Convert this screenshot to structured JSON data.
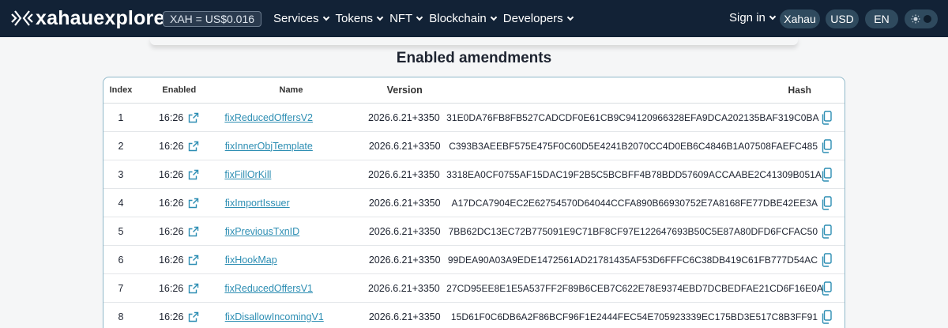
{
  "header": {
    "logo_text": "xahauexplorer",
    "price": "XAH = US$0.016",
    "nav": [
      "Services",
      "Tokens",
      "NFT",
      "Blockchain",
      "Developers"
    ],
    "signin": "Sign in",
    "network": "Xahau",
    "currency": "USD",
    "language": "EN",
    "accent": "#2f4a5e"
  },
  "page": {
    "title": "Enabled amendments"
  },
  "table": {
    "headers": {
      "index": "Index",
      "enabled": "Enabled",
      "name": "Name",
      "version": "Version",
      "hash": "Hash"
    },
    "rows": [
      {
        "index": "1",
        "enabled": "16:26",
        "name": "fixReducedOffersV2",
        "version": "2026.6.21+3350",
        "hash": "31E0DA76FB8FB527CADCDF0E61CB9C94120966328EFA9DCA202135BAF319C0BA"
      },
      {
        "index": "2",
        "enabled": "16:26",
        "name": "fixInnerObjTemplate",
        "version": "2026.6.21+3350",
        "hash": "C393B3AEEBF575E475F0C60D5E4241B2070CC4D0EB6C4846B1A07508FAEFC485"
      },
      {
        "index": "3",
        "enabled": "16:26",
        "name": "fixFillOrKill",
        "version": "2026.6.21+3350",
        "hash": "3318EA0CF0755AF15DAC19F2B5C5BCBFF4B78BDD57609ACCAABE2C41309B051A"
      },
      {
        "index": "4",
        "enabled": "16:26",
        "name": "fixImportIssuer",
        "version": "2026.6.21+3350",
        "hash": "A17DCA7904EC2E62754570D64044CCFA890B66930752E7A8168FE77DBE42EE3A"
      },
      {
        "index": "5",
        "enabled": "16:26",
        "name": "fixPreviousTxnID",
        "version": "2026.6.21+3350",
        "hash": "7BB62DC13EC72B775091E9C71BF8CF97E122647693B50C5E87A80DFD6FCFAC50"
      },
      {
        "index": "6",
        "enabled": "16:26",
        "name": "fixHookMap",
        "version": "2026.6.21+3350",
        "hash": "99DEA90A03A9EDE1472561AD21781435AF53D6FFFC6C38DB419C61FB777D54AC"
      },
      {
        "index": "7",
        "enabled": "16:26",
        "name": "fixReducedOffersV1",
        "version": "2026.6.21+3350",
        "hash": "27CD95EE8E1E5A537FF2F89B6CEB7C622E78E9374EBD7DCBEDFAE21CD6F16E0A"
      },
      {
        "index": "8",
        "enabled": "16:26",
        "name": "fixDisallowIncomingV1",
        "version": "2026.6.21+3350",
        "hash": "15D61F0C6DB6A2F86BCF96F1E2444FEC54E705923339EC175BD3E517C8B3FF91"
      }
    ]
  },
  "icons": {
    "external_link": "external-link-icon",
    "copy": "copy-icon",
    "sun": "sun-icon",
    "link_color": "#2d8eb3"
  }
}
